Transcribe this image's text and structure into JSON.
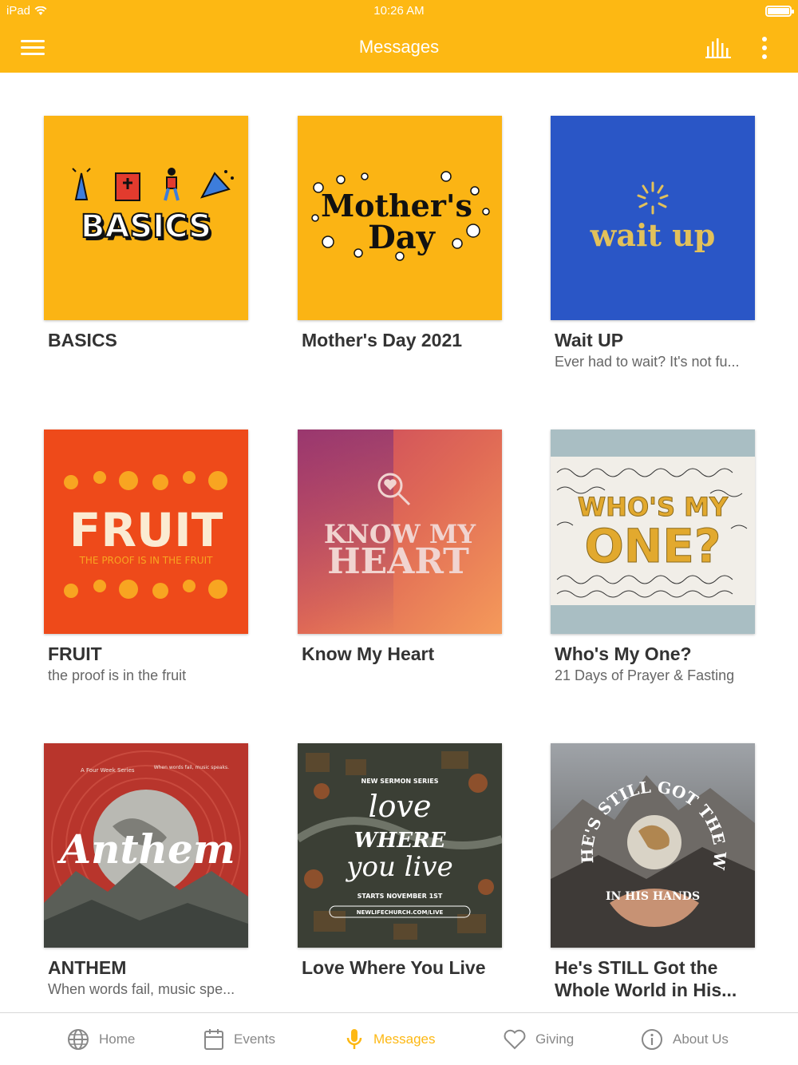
{
  "status_bar": {
    "device": "iPad",
    "time": "10:26 AM"
  },
  "header": {
    "title": "Messages"
  },
  "series": [
    {
      "title": "BASICS",
      "subtitle": "",
      "art_text": "BASICS"
    },
    {
      "title": "Mother's Day 2021",
      "subtitle": "",
      "art_text": [
        "Mother's",
        "Day"
      ]
    },
    {
      "title": "Wait UP",
      "subtitle": "Ever had to wait? It's not fu...",
      "art_text": "wait up"
    },
    {
      "title": "FRUIT",
      "subtitle": "the proof is in the fruit",
      "art_text": [
        "FRUIT",
        "THE PROOF IS IN THE FRUIT"
      ]
    },
    {
      "title": "Know My Heart",
      "subtitle": "",
      "art_text": [
        "KNOW MY",
        "HEART"
      ]
    },
    {
      "title": "Who's My One?",
      "subtitle": "21 Days of Prayer & Fasting",
      "art_text": [
        "WHO'S MY",
        "ONE?"
      ]
    },
    {
      "title": "ANTHEM",
      "subtitle": "When words fail, music spe...",
      "art_text": [
        "Anthem",
        "A Four Week Series",
        "When words fail, music speaks."
      ]
    },
    {
      "title": "Love Where You Live",
      "subtitle": "",
      "art_text": [
        "NEW SERMON SERIES",
        "love",
        "WHERE",
        "you live",
        "STARTS NOVEMBER 1ST",
        "NEWLIFECHURCH.COM/LIVE"
      ]
    },
    {
      "title": "He's STILL Got the Whole World in His...",
      "subtitle": "",
      "art_text": [
        "HE'S STILL GOT THE WHOLE",
        "IN HIS HANDS"
      ]
    }
  ],
  "tabs": [
    {
      "label": "Home",
      "icon": "globe-icon"
    },
    {
      "label": "Events",
      "icon": "calendar-icon"
    },
    {
      "label": "Messages",
      "icon": "microphone-icon",
      "active": true
    },
    {
      "label": "Giving",
      "icon": "heart-icon"
    },
    {
      "label": "About Us",
      "icon": "info-icon"
    }
  ],
  "colors": {
    "accent": "#FDB813",
    "header_bg": "#FDB813",
    "inactive_tab": "#888888"
  }
}
